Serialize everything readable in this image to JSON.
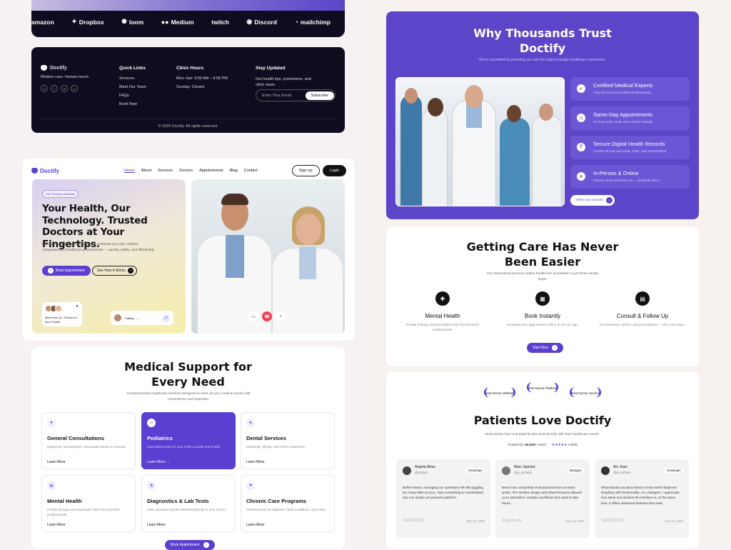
{
  "logos": [
    "amazon",
    "Dropbox",
    "loom",
    "Medium",
    "twitch",
    "Discord",
    "mailchimp"
  ],
  "footer": {
    "brand": "Doctify",
    "tagline": "Modern care. Human touch.",
    "ql_title": "Quick Links",
    "ql": [
      "Services",
      "Meet Our Team",
      "FAQs",
      "Book Now"
    ],
    "hours_title": "Clinic Hours",
    "hours": [
      "Mon–Sat: 9:00 AM – 8:00 PM",
      "Sunday: Closed"
    ],
    "stay_title": "Stay Updated",
    "stay_text": "Get health tips, promotions, and clinic news.",
    "email_ph": "Enter Your Email",
    "subscribe": "Subscribe",
    "copy": "© 2025 Doctify. All rights reserved."
  },
  "nav": {
    "brand": "Doctify",
    "links": [
      "Home",
      "About",
      "Services",
      "Doctors",
      "Appointments",
      "Blog",
      "Contact"
    ],
    "signup": "Sign up",
    "login": "Login"
  },
  "hero": {
    "badge": "24/7 Services Availalbe",
    "title": "Your Health, Our Technology. Trusted Doctors at Your Fingertips.",
    "sub": "Whether in person or online, Doctify connects you with certified, compassionate healthcare professionals — quickly, safely, and effortlessly.",
    "book": "Book Appointment",
    "how": "See How It Works",
    "doctors_text": "More than 1k+ Doctors in your Doctify",
    "calling": "Calling........"
  },
  "ms": {
    "title": "Medical Support for Every Need",
    "sub": "Comprehensive healthcare services designed to meet all your medical needs with convenience and expertise.",
    "items": [
      {
        "t": "General Consultations",
        "d": "Diagnosis, prescriptions, and expert advice in minutes.",
        "l": "Learn More"
      },
      {
        "t": "Pediatrics",
        "d": "Specialized care for your child's growth and health.",
        "l": "Learn More →"
      },
      {
        "t": "Dental Services",
        "d": "Cleanings, fillings, and smile makeovers.",
        "l": "Learn More"
      },
      {
        "t": "Mental Health",
        "d": "Private therapy and psychiatric help from licensed professionals.",
        "l": "Learn More"
      },
      {
        "t": "Diagnostics & Lab Tests",
        "d": "Fast, accurate reports delivered directly to your phone.",
        "l": "Learn More"
      },
      {
        "t": "Chronic Care Programs",
        "d": "Tailored plans for diabetes, heart conditions, and more.",
        "l": "Learn More"
      }
    ],
    "book": "Book Appointment"
  },
  "trust": {
    "title": "Why Thousands Trust Doctify",
    "sub": "We're committed to providing you with the highest quality healthcare experience.",
    "features": [
      {
        "t": "Certified Medical Experts",
        "d": "Only licensed and verified professionals."
      },
      {
        "t": "Same-Day Appointments",
        "d": "No long waits. Book and consult instantly."
      },
      {
        "t": "Secure Digital Health Records",
        "d": "Access all your past visits, tests, and prescriptions."
      },
      {
        "t": "In-Person & Online",
        "d": "Choose what works for you — physical clinics."
      }
    ],
    "meet": "Meet Our Doctors"
  },
  "easy": {
    "title": "Getting Care Has Never Been Easier",
    "sub": "Our streamlined process makes healthcare accessible in just three simple steps.",
    "steps": [
      {
        "t": "Mental Health",
        "d": "Private therapy and psychiatric help from licensed professionals."
      },
      {
        "t": "Book Instantly",
        "d": "Schedule your appointment online or via our app."
      },
      {
        "t": "Consult & Follow Up",
        "d": "Get treatment, advice, and prescriptions — all in one place."
      }
    ],
    "start": "Start Now"
  },
  "pat": {
    "awards": [
      "Best Doctor Website",
      "Best Doctor Platform",
      "Best Doctor Service"
    ],
    "title": "Patients Love Doctify",
    "sub": "Real stories from real patients who trust Doctify with their healthcare needs.",
    "trusted": "Trusted by",
    "count": "58,980+",
    "users": "users",
    "rating": "4.86/5",
    "reviews": [
      {
        "n": "Angela Moss",
        "h": "@an4gel",
        "r": "Developer",
        "t": "Before Beam, managing our operations felt like juggling too many balls at once. Now, everything is consolidated into one simple yet powerful platform.",
        "c": "VEROXOOC",
        "d": "Dec 12, 2025"
      },
      {
        "n": "Marc Spector",
        "h": "@jz_arche9",
        "r": "Designer",
        "t": "Beam has completely revolutionized how our team works. The intuitive design and robust features allowed us to streamline complex workflows that used to take hours.",
        "c": "Angelitude",
        "d": "Dec 12, 2025"
      },
      {
        "n": "Arc Joan",
        "h": "@jz_arche9",
        "r": "Developer",
        "t": "What stands out about Beam is how well it balances simplicity with functionality. As a designer, I appreciate how sleek and intuitive the interface is. At the same time, it offers advanced features that meet.",
        "c": "VEROXOOC",
        "d": "Dec 12, 2025"
      }
    ]
  }
}
